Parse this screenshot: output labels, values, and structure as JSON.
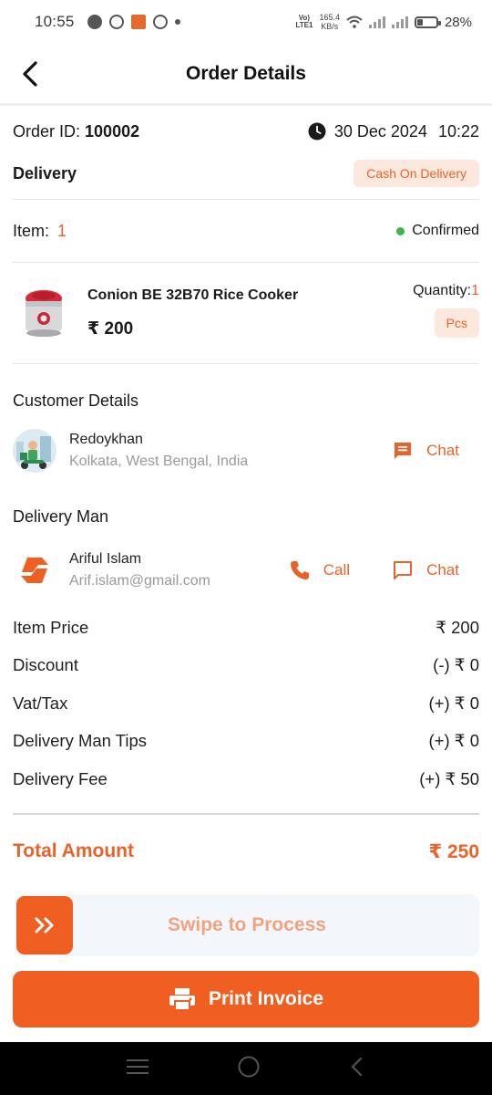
{
  "status_bar": {
    "time": "10:55",
    "network_label_top": "Vo)",
    "network_label_bottom": "LTE1",
    "speed_value": "165.4",
    "speed_unit": "KB/s",
    "battery": "28%",
    "battery_level": 0.28
  },
  "header": {
    "title": "Order Details",
    "back_icon": "back-arrow-icon"
  },
  "order": {
    "id_label": "Order ID:",
    "id_value": "100002",
    "date": "30 Dec 2024",
    "time": "10:22",
    "type": "Delivery",
    "payment_badge": "Cash On Delivery",
    "item_label": "Item:",
    "item_count": "1",
    "status": "Confirmed",
    "status_color": "#3fb44a"
  },
  "product": {
    "name": "Conion BE 32B70 Rice Cooker",
    "price": "₹ 200",
    "quantity_label": "Quantity:",
    "quantity_value": "1",
    "unit": "Pcs"
  },
  "customer": {
    "section_title": "Customer Details",
    "name": "Redoykhan",
    "address": "Kolkata, West Bengal, India",
    "chat_label": "Chat"
  },
  "delivery_man": {
    "section_title": "Delivery Man",
    "name": "Ariful Islam",
    "email": "Arif.islam@gmail.com",
    "call_label": "Call",
    "chat_label": "Chat"
  },
  "summary": [
    {
      "label": "Item Price",
      "value": "₹ 200"
    },
    {
      "label": "Discount",
      "value": "(-) ₹ 0"
    },
    {
      "label": "Vat/Tax",
      "value": "(+) ₹ 0"
    },
    {
      "label": "Delivery Man Tips",
      "value": "(+) ₹ 0"
    },
    {
      "label": "Delivery Fee",
      "value": "(+) ₹ 50"
    }
  ],
  "total": {
    "label": "Total Amount",
    "value": "₹ 250"
  },
  "actions": {
    "swipe_label": "Swipe to Process",
    "print_label": "Print Invoice"
  },
  "colors": {
    "accent": "#f05f22",
    "accent_text": "#e8632a",
    "badge_bg": "#fde8de"
  }
}
